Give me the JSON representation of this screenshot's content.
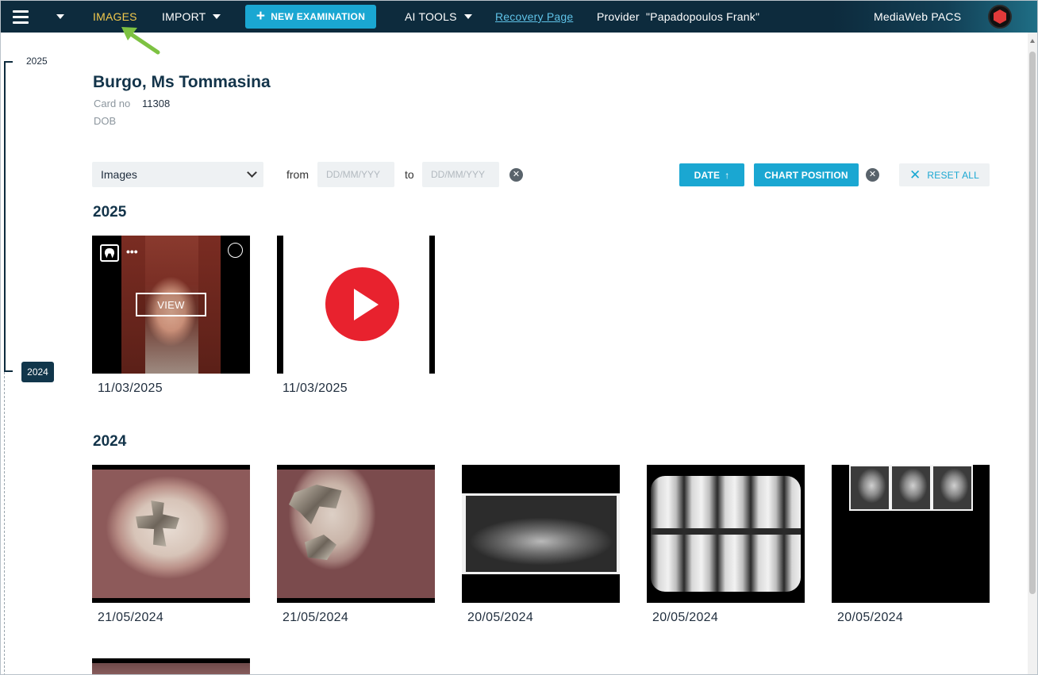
{
  "topbar": {
    "menu_icon": "hamburger-icon",
    "images_label": "IMAGES",
    "import_label": "IMPORT",
    "new_exam_label": "NEW EXAMINATION",
    "ai_tools_label": "AI TOOLS",
    "recovery_label": "Recovery Page",
    "provider_label": "Provider",
    "provider_name": "\"Papadopoulos Frank\"",
    "app_name": "MediaWeb PACS",
    "accent_color": "#1aa7d2",
    "active_color": "#f2c94c",
    "bar_color": "#0d2b3d"
  },
  "timeline": {
    "top_year": "2025",
    "active_year": "2024"
  },
  "patient": {
    "name": "Burgo, Ms Tommasina",
    "card_label": "Card no",
    "card_value": "11308",
    "dob_label": "DOB"
  },
  "filters": {
    "type_selected": "Images",
    "from_label": "from",
    "from_placeholder": "DD/MM/YYY",
    "to_label": "to",
    "to_placeholder": "DD/MM/YYY",
    "sort_date_label": "DATE",
    "chart_position_label": "CHART POSITION",
    "reset_label": "RESET ALL"
  },
  "sections": [
    {
      "year": "2025",
      "items": [
        {
          "date": "11/03/2025",
          "kind": "photo",
          "view_label": "VIEW"
        },
        {
          "date": "11/03/2025",
          "kind": "video"
        }
      ]
    },
    {
      "year": "2024",
      "items": [
        {
          "date": "21/05/2024",
          "kind": "intraoral"
        },
        {
          "date": "21/05/2024",
          "kind": "intraoral"
        },
        {
          "date": "20/05/2024",
          "kind": "panoramic-xray"
        },
        {
          "date": "20/05/2024",
          "kind": "bitewing-xray"
        },
        {
          "date": "20/05/2024",
          "kind": "cephalometric-xray"
        }
      ]
    }
  ]
}
